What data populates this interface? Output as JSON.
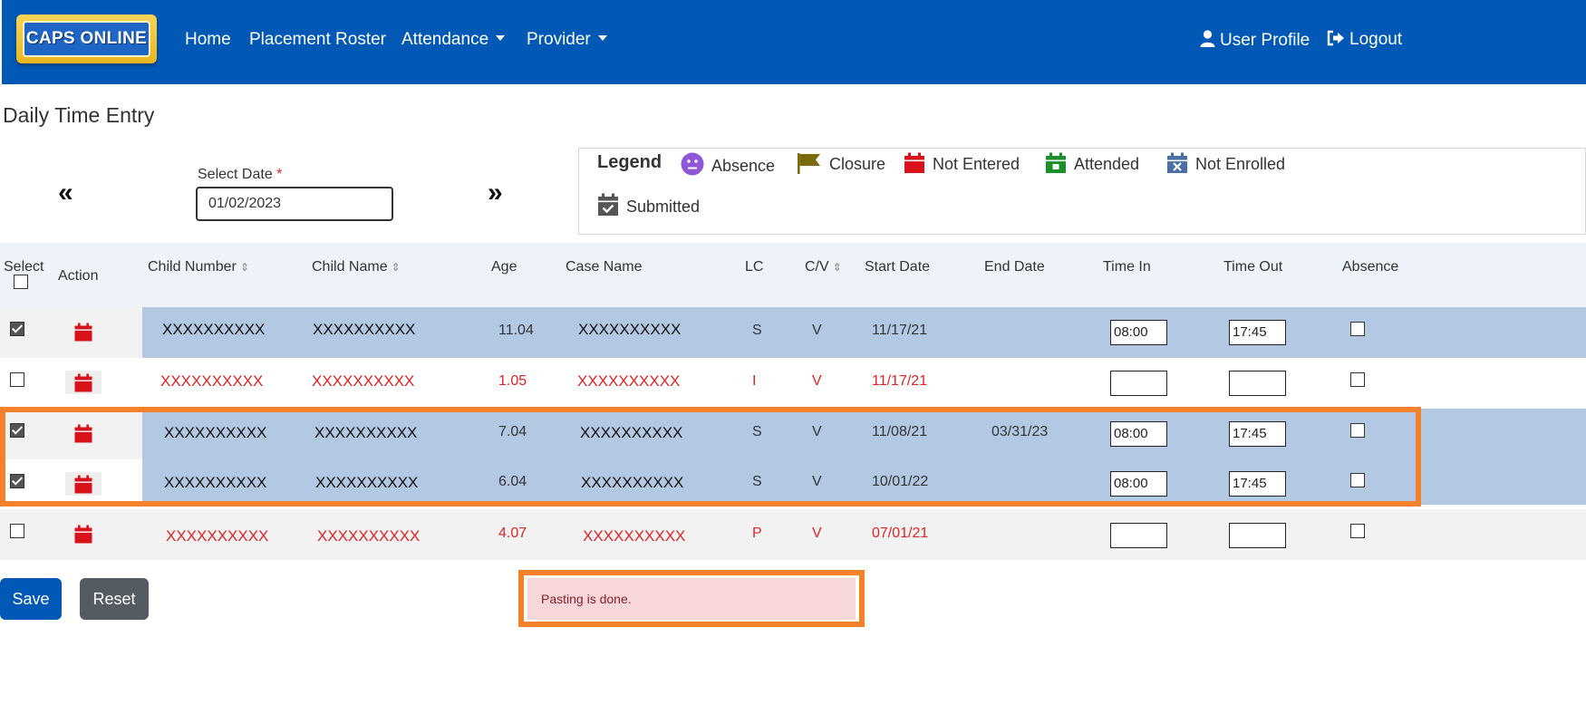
{
  "app": {
    "logo_text": "CAPS ONLINE"
  },
  "nav": {
    "home": "Home",
    "placement_roster": "Placement Roster",
    "attendance": "Attendance",
    "provider": "Provider",
    "user_profile": "User Profile",
    "logout": "Logout"
  },
  "page": {
    "title": "Daily Time Entry",
    "prev_symbol": "«",
    "next_symbol": "»",
    "date_label": "Select Date",
    "date_required": "*",
    "date_value": "01/02/2023"
  },
  "legend": {
    "title": "Legend",
    "absence": "Absence",
    "closure": "Closure",
    "not_entered": "Not Entered",
    "attended": "Attended",
    "not_enrolled": "Not Enrolled",
    "submitted": "Submitted"
  },
  "colors": {
    "navbar": "#0158b5",
    "row_selected": "#b3c9e3",
    "row_alt": "#f2f2f2",
    "text_red": "#e02424",
    "highlight_outline": "#f5822a",
    "save_button": "#0158b5",
    "reset_button": "#545b62",
    "toast_bg": "#f8d7da"
  },
  "table": {
    "headers": {
      "select": "Select",
      "action": "Action",
      "child_number": "Child Number",
      "child_name": "Child Name",
      "age": "Age",
      "case_name": "Case Name",
      "lc": "LC",
      "cv": "C/V",
      "start_date": "Start Date",
      "end_date": "End Date",
      "time_in": "Time In",
      "time_out": "Time Out",
      "absence": "Absence"
    },
    "sort_icon": "⇕",
    "rows": [
      {
        "child_number": "XXXXXXXXXX",
        "child_name": "XXXXXXXXXX",
        "age": "11.04",
        "case_name": "XXXXXXXXXX",
        "lc": "S",
        "cv": "V",
        "start_date": "11/17/21",
        "end_date": "",
        "time_in": "08:00",
        "time_out": "17:45"
      },
      {
        "child_number": "XXXXXXXXXX",
        "child_name": "XXXXXXXXXX",
        "age": "1.05",
        "case_name": "XXXXXXXXXX",
        "lc": "I",
        "cv": "V",
        "start_date": "11/17/21",
        "end_date": "",
        "time_in": "",
        "time_out": ""
      },
      {
        "child_number": "XXXXXXXXXX",
        "child_name": "XXXXXXXXXX",
        "age": "7.04",
        "case_name": "XXXXXXXXXX",
        "lc": "S",
        "cv": "V",
        "start_date": "11/08/21",
        "end_date": "03/31/23",
        "time_in": "08:00",
        "time_out": "17:45"
      },
      {
        "child_number": "XXXXXXXXXX",
        "child_name": "XXXXXXXXXX",
        "age": "6.04",
        "case_name": "XXXXXXXXXX",
        "lc": "S",
        "cv": "V",
        "start_date": "10/01/22",
        "end_date": "",
        "time_in": "08:00",
        "time_out": "17:45"
      },
      {
        "child_number": "XXXXXXXXXX",
        "child_name": "XXXXXXXXXX",
        "age": "4.07",
        "case_name": "XXXXXXXXXX",
        "lc": "P",
        "cv": "V",
        "start_date": "07/01/21",
        "end_date": "",
        "time_in": "",
        "time_out": ""
      }
    ]
  },
  "actions": {
    "save": "Save",
    "reset": "Reset"
  },
  "toast": {
    "message": "Pasting is done."
  }
}
